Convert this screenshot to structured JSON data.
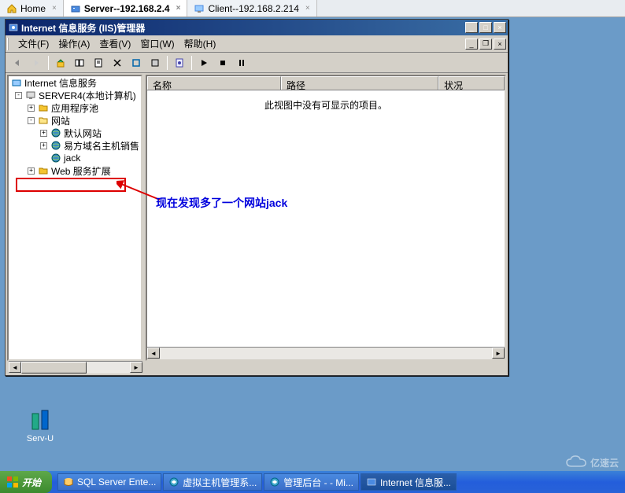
{
  "browser_tabs": [
    {
      "label": "Home",
      "icon": "home"
    },
    {
      "label": "Server--192.168.2.4",
      "icon": "server",
      "active": true
    },
    {
      "label": "Client--192.168.2.214",
      "icon": "client"
    }
  ],
  "iis": {
    "title": "Internet 信息服务 (IIS)管理器",
    "menu": {
      "file": "文件(F)",
      "action": "操作(A)",
      "view": "查看(V)",
      "window": "窗口(W)",
      "help": "帮助(H)"
    },
    "tree": {
      "root": "Internet 信息服务",
      "server": "SERVER4(本地计算机)",
      "app_pools": "应用程序池",
      "websites": "网站",
      "default_site": "默认网站",
      "yifang_site": "易方域名主机销售",
      "jack_site": "jack",
      "web_ext": "Web 服务扩展"
    },
    "columns": {
      "name": "名称",
      "path": "路径",
      "status": "状况"
    },
    "empty_message": "此视图中没有可显示的项目。"
  },
  "annotation": "现在发现多了一个网站jack",
  "desktop": {
    "servu_label": "Serv-U"
  },
  "taskbar": {
    "start": "开始",
    "tasks": [
      "SQL Server Ente...",
      "虚拟主机管理系...",
      "管理后台 - - Mi...",
      "Internet 信息服..."
    ]
  },
  "watermark": "亿速云"
}
